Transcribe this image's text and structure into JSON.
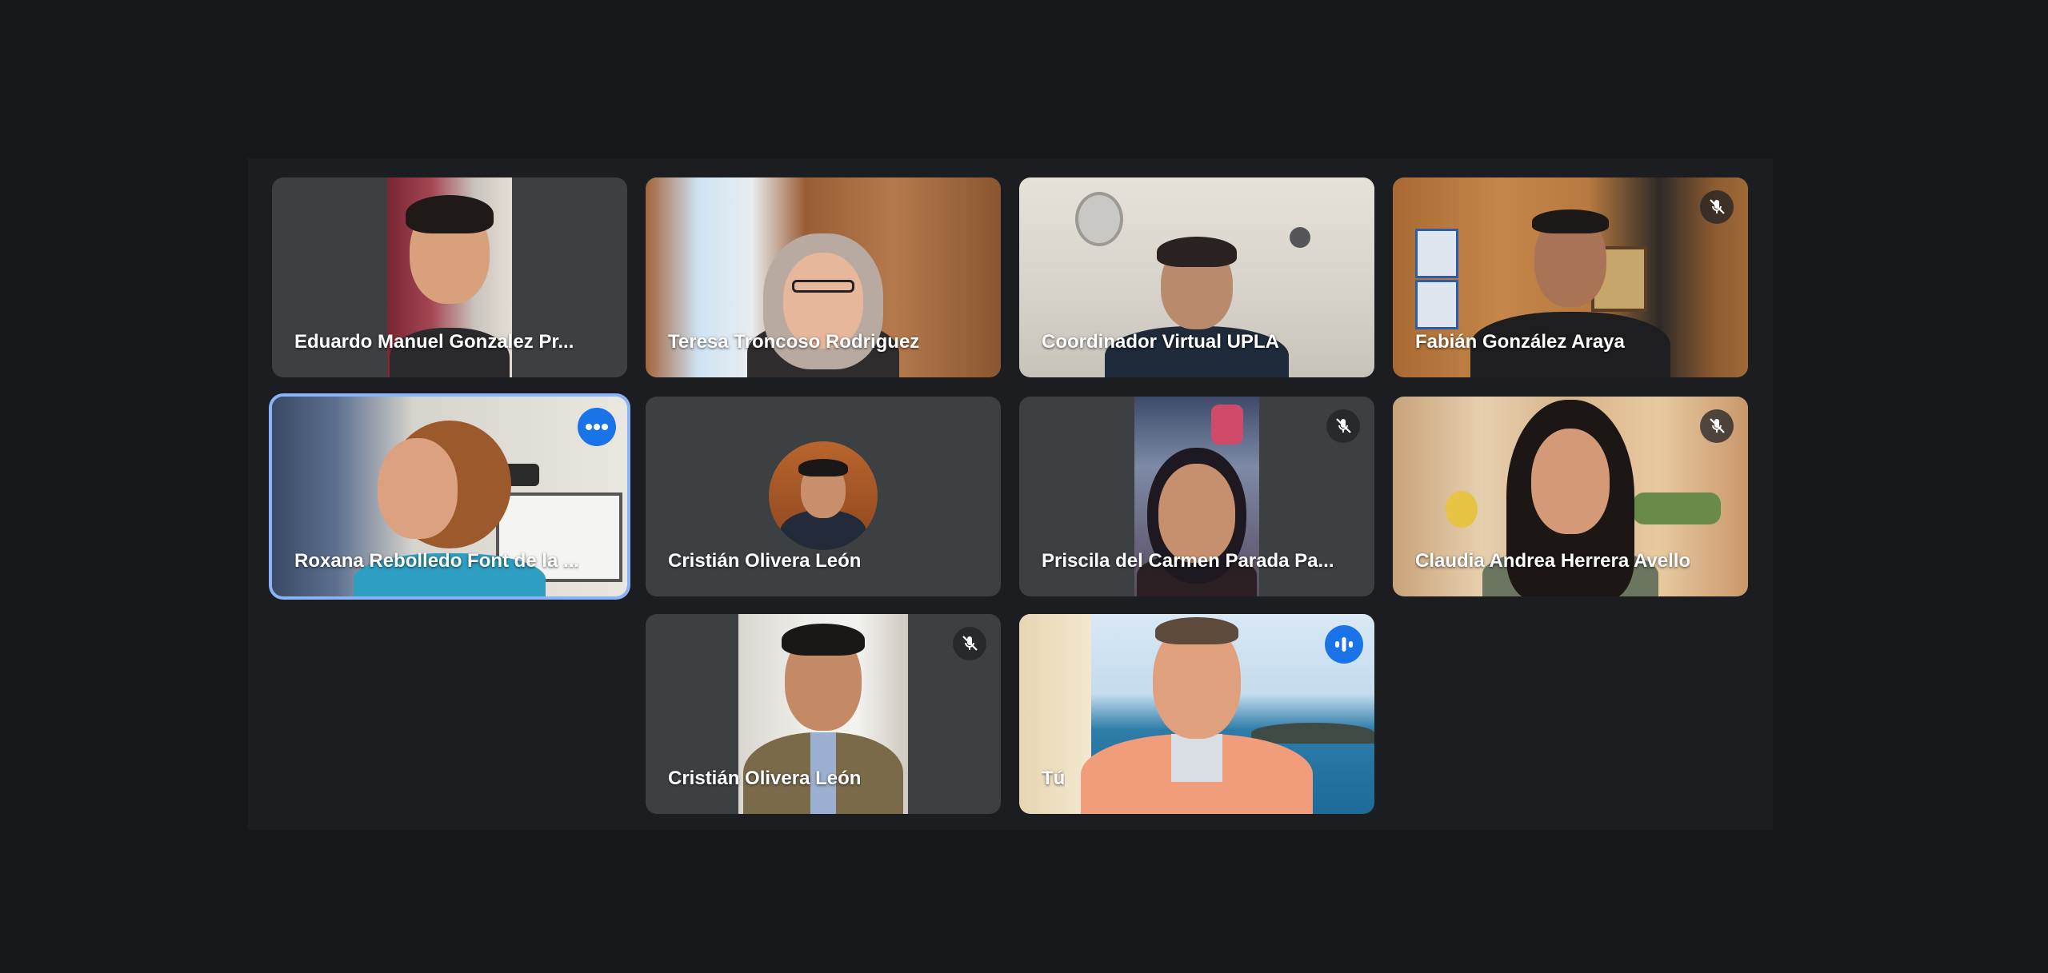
{
  "participants": [
    {
      "name": "Eduardo Manuel Gonzalez Pr...",
      "muted": false
    },
    {
      "name": "Teresa Troncoso Rodriguez",
      "muted": false
    },
    {
      "name": "Coordinador Virtual UPLA",
      "muted": false
    },
    {
      "name": "Fabián González Araya",
      "muted": true
    },
    {
      "name": "Roxana Rebolledo Font de la ...",
      "muted": false,
      "active": true
    },
    {
      "name": "Cristián Olivera León",
      "muted": false,
      "video": false
    },
    {
      "name": "Priscila del Carmen Parada Pa...",
      "muted": true
    },
    {
      "name": "Claudia Andrea Herrera Avello",
      "muted": true
    },
    {
      "name": "Cristián Olivera León",
      "muted": true
    },
    {
      "name": "Tú",
      "muted": false,
      "speaking": true
    }
  ],
  "icons": {
    "mute": "mic-off-icon",
    "more": "more-options-icon",
    "speaking": "audio-level-icon"
  },
  "colors": {
    "background": "#15171b",
    "tile": "#3c4043",
    "active_border": "#8ab4f8",
    "accent_blue": "#1a73e8"
  }
}
